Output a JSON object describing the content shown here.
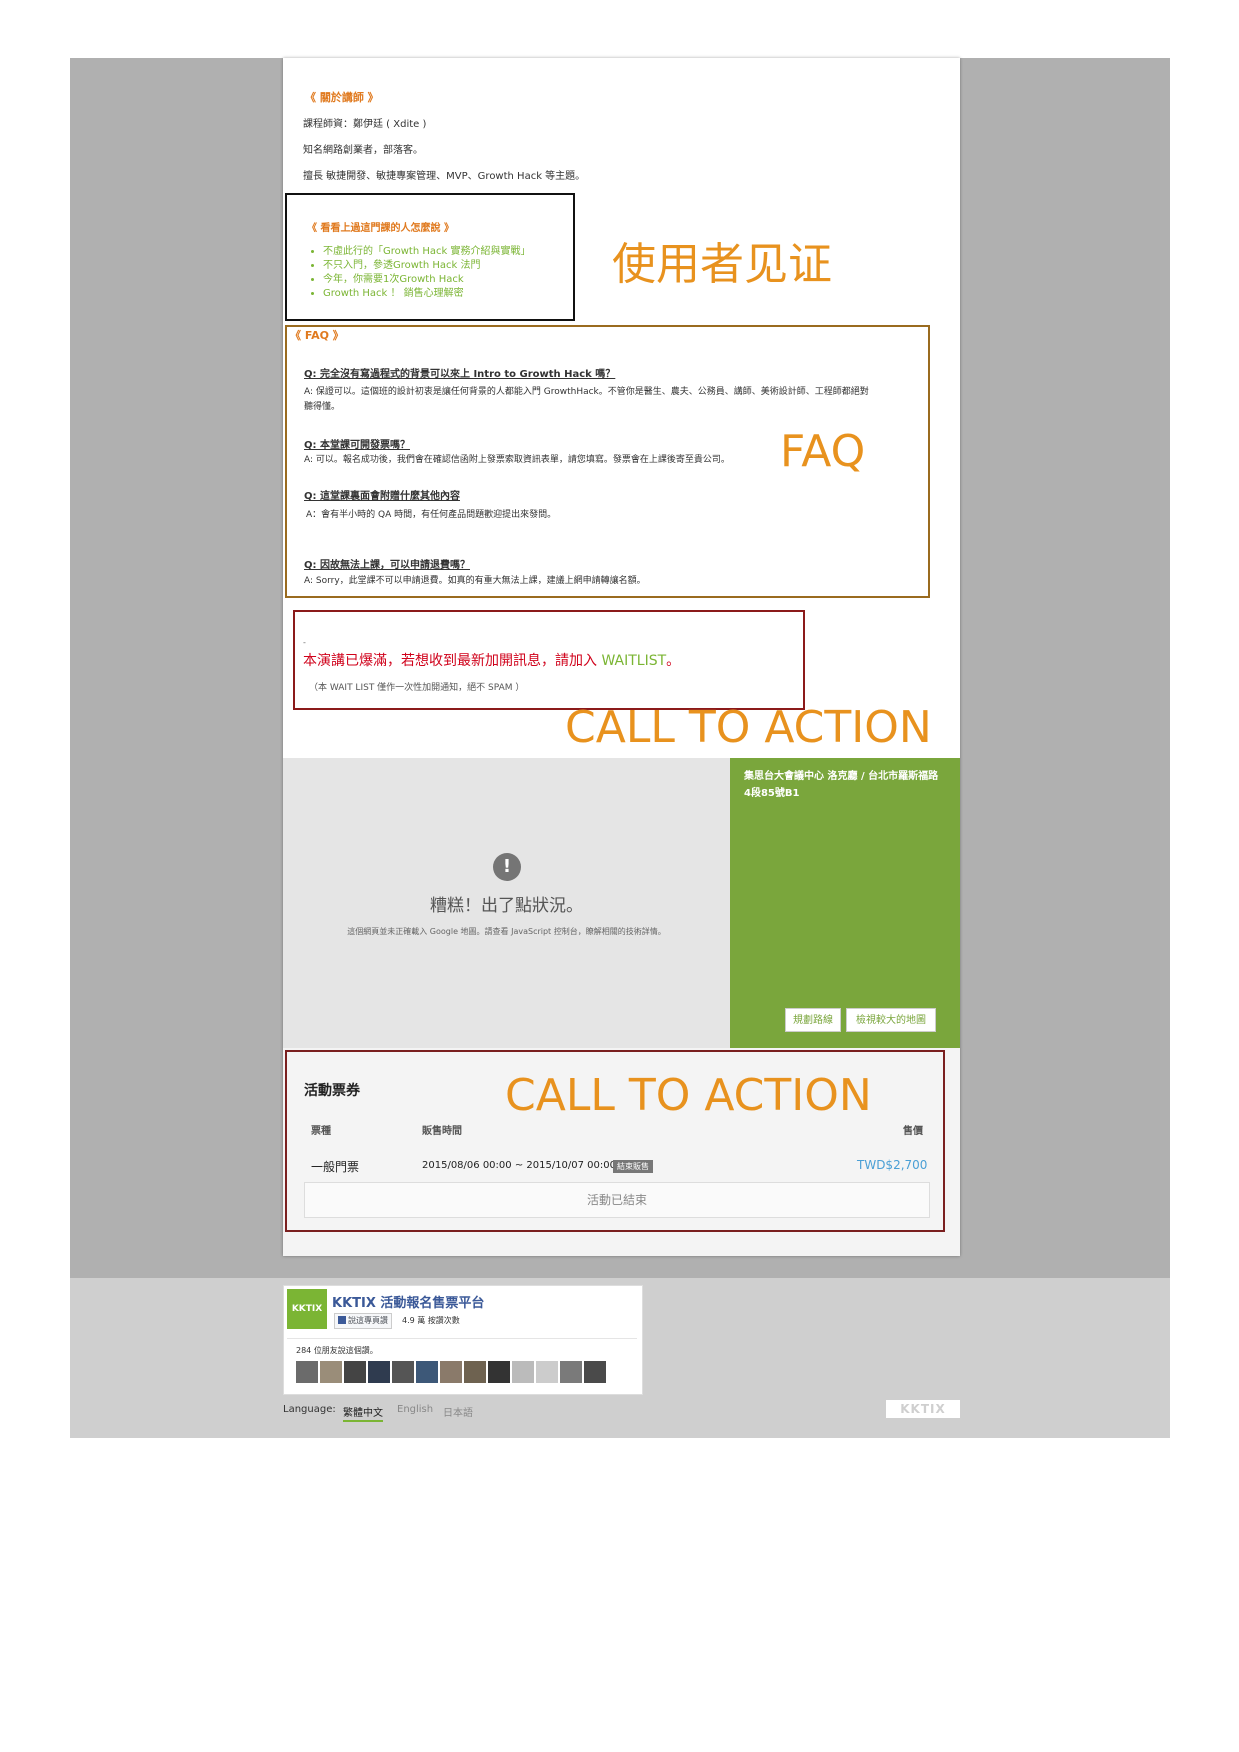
{
  "instructor": {
    "heading": "《 關於講師 》",
    "line1": "課程師資：鄭伊廷 ( Xdite )",
    "line2": "知名網路創業者，部落客。",
    "line3": "擅長 敏捷開發、敏捷專案管理、MVP、Growth Hack 等主題。"
  },
  "testimonials": {
    "heading": "《 看看上過這門課的人怎麼說 》",
    "items": [
      "不虛此行的「Growth Hack 實務介紹與實戰」",
      "不只入門，參透Growth Hack 法門",
      "今年，你需要1次Growth Hack",
      "Growth Hack ！ 銷售心理解密"
    ],
    "annotation": "使用者见证"
  },
  "faq": {
    "heading": "《 FAQ 》",
    "annotation": "FAQ",
    "q1": "Q: 完全沒有寫過程式的背景可以來上 Intro to Growth Hack 嗎？",
    "a1a": "A: 保證可以。這個班的設計初衷是讓任何背景的人都能入門 GrowthHack。不管你是醫生、農夫、公務員、講師、美術設計師、工程師都絕對",
    "a1b": "聽得懂。",
    "q2": "Q: 本堂課可開發票嗎？",
    "a2": "A: 可以。報名成功後，我們會在確認信函附上發票索取資訊表單，請您填寫。發票會在上課後寄至貴公司。",
    "q3": "Q: 這堂課裏面會附贈什麼其他內容",
    "a3": "A：會有半小時的 QA 時間，有任何產品問題歡迎提出來發問。",
    "q4": "Q: 因故無法上課，可以申請退費嗎？",
    "a4": "A: Sorry，此堂課不可以申請退費。如真的有重大無法上課，建議上網申請轉讓名額。"
  },
  "waitlist": {
    "dash": "-",
    "main": "本演講已爆滿，若想收到最新加開訊息，請加入 ",
    "link": "WAITLIST",
    "period": "。",
    "note": "（本 WAIT LIST 僅作一次性加開通知，絕不 SPAM ）",
    "annotation": "CALL TO ACTION"
  },
  "map": {
    "error_title": "糟糕！出了點狀況。",
    "error_desc": "這個網頁並未正確載入 Google 地圖。請查看 JavaScript 控制台，瞭解相關的技術詳情。",
    "address": "集思台大會議中心 洛克廳 / 台北市羅斯福路4段85號B1",
    "route_button": "規劃路線",
    "enlarge_button": "檢視較大的地圖"
  },
  "tickets": {
    "title": "活動票券",
    "annotation": "CALL TO ACTION",
    "col_type": "票種",
    "col_time": "販售時間",
    "col_price": "售價",
    "row_type": "一般門票",
    "row_time": "2015/08/06 00:00 ~ 2015/10/07 00:00",
    "row_badge": "結束販售",
    "row_price": "TWD$2,700",
    "ended_button": "活動已結束"
  },
  "facebook": {
    "logo": "KKTIX",
    "page_name": "KKTIX 活動報名售票平台",
    "like_button": "說這專頁讚",
    "likes": "4.9 萬 按讚次數",
    "friends": "284 位朋友說這個讚。"
  },
  "footer": {
    "language_label": "Language:",
    "lang_zh": "繁體中文",
    "lang_en": "English",
    "lang_ja": "日本語",
    "logo": "KKTIX"
  },
  "colors": {
    "accent_orange": "#e8921e",
    "heading_orange": "#e07a1f",
    "link_green": "#7bb534",
    "map_green": "#7aa63c",
    "alert_red": "#d0021b",
    "price_blue": "#4a9fd5"
  }
}
